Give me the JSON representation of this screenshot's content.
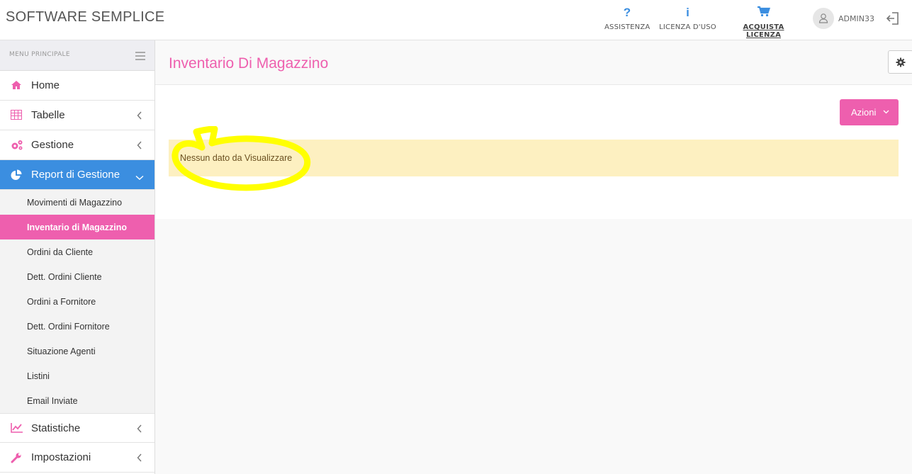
{
  "app": {
    "brand": "SOFTWARE SEMPLICE"
  },
  "topnav": {
    "items": [
      {
        "icon": "question-icon",
        "label": "ASSISTENZA"
      },
      {
        "icon": "info-icon",
        "label": "LICENZA D'USO"
      },
      {
        "icon": "cart-icon",
        "label": "ACQUISTA LICENZA"
      }
    ],
    "user": "ADMIN33"
  },
  "sidebar": {
    "header": "MENU PRINCIPALE",
    "items": [
      {
        "label": "Home",
        "icon": "home-icon"
      },
      {
        "label": "Tabelle",
        "icon": "table-icon"
      },
      {
        "label": "Gestione",
        "icon": "gears-icon"
      },
      {
        "label": "Report di Gestione",
        "icon": "pie-chart-icon"
      },
      {
        "label": "Statistiche",
        "icon": "line-chart-icon"
      },
      {
        "label": "Impostazioni",
        "icon": "wrench-icon"
      }
    ],
    "subitems": [
      "Movimenti di Magazzino",
      "Inventario di Magazzino",
      "Ordini da Cliente",
      "Dett. Ordini Cliente",
      "Ordini a Fornitore",
      "Dett. Ordini Fornitore",
      "Situazione Agenti",
      "Listini",
      "Email Inviate"
    ]
  },
  "main": {
    "title": "Inventario Di Magazzino",
    "actions_label": "Azioni",
    "alert": "Nessun dato da Visualizzare"
  },
  "colors": {
    "accent_pink": "#ee5fae",
    "accent_blue": "#3b8ee0",
    "alert_bg": "#fdf0c1",
    "highlight": "#ffff00"
  }
}
